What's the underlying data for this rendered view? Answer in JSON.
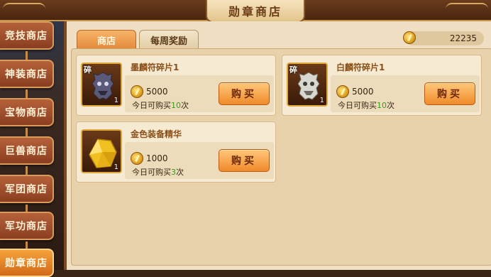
{
  "title": "勋章商店",
  "sidebar": {
    "items": [
      {
        "label": "竞技商店"
      },
      {
        "label": "神装商店"
      },
      {
        "label": "宝物商店"
      },
      {
        "label": "巨兽商店"
      },
      {
        "label": "军团商店"
      },
      {
        "label": "军功商店"
      },
      {
        "label": "勋章商店"
      }
    ],
    "active_index": 6
  },
  "tabs": [
    {
      "label": "商店"
    },
    {
      "label": "每周奖励"
    }
  ],
  "currency": {
    "icon": "medal-icon",
    "amount": "22235"
  },
  "items": [
    {
      "name": "墨麟符碎片1",
      "price": "5000",
      "limit_prefix": "今日可购买",
      "limit_count": "10",
      "limit_suffix": "次",
      "count": "1",
      "fragment_label": "碎",
      "buy_label": "购买",
      "icon": "dark-beast-mask-icon"
    },
    {
      "name": "白麟符碎片1",
      "price": "5000",
      "limit_prefix": "今日可购买",
      "limit_count": "10",
      "limit_suffix": "次",
      "count": "1",
      "fragment_label": "碎",
      "buy_label": "购买",
      "icon": "white-beast-mask-icon"
    },
    {
      "name": "金色装备精华",
      "price": "1000",
      "limit_prefix": "今日可购买",
      "limit_count": "3",
      "limit_suffix": "次",
      "count": "1",
      "fragment_label": "",
      "buy_label": "购买",
      "icon": "gold-gem-icon"
    }
  ],
  "colors": {
    "accent": "#e38a3a",
    "limit_count": "#3a9a18",
    "item_name": "#8a5018"
  }
}
